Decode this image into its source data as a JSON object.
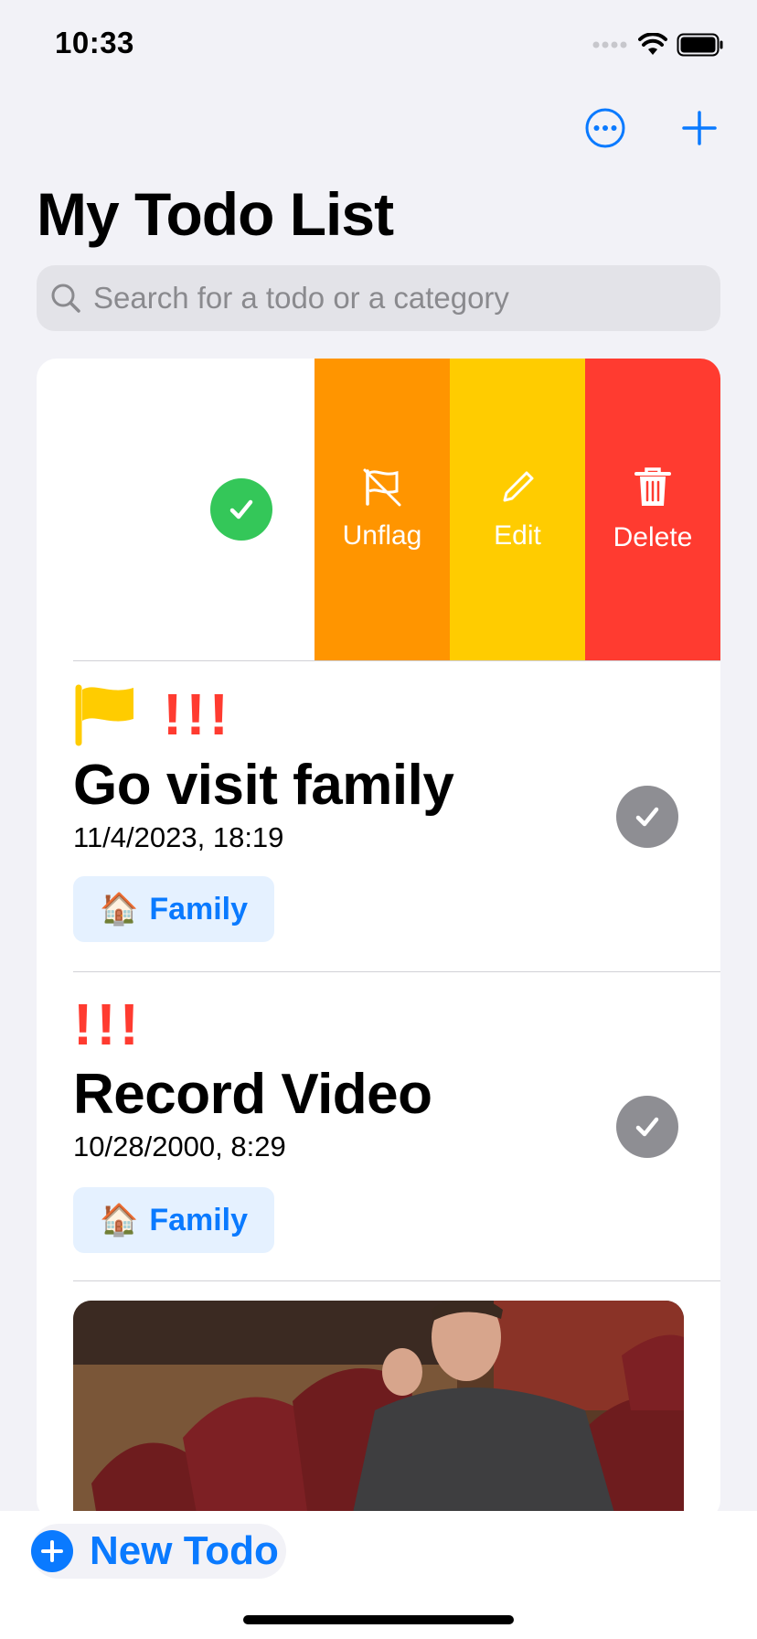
{
  "status_bar": {
    "time": "10:33"
  },
  "nav": {
    "more_icon": "ellipsis-circle-icon",
    "add_icon": "plus-icon"
  },
  "page": {
    "title": "My Todo List"
  },
  "search": {
    "placeholder": "Search for a todo or a category",
    "value": ""
  },
  "swipe_actions": {
    "unflag_label": "Unflag",
    "edit_label": "Edit",
    "delete_label": "Delete",
    "colors": {
      "unflag": "#ff9500",
      "edit": "#ffcc00",
      "delete": "#ff3b30",
      "complete": "#34c759"
    }
  },
  "todos": [
    {
      "flagged": true,
      "priority": "!!!",
      "title": "Go visit family",
      "date": "11/4/2023, 18:19",
      "category": {
        "emoji": "🏠",
        "name": "Family"
      }
    },
    {
      "flagged": false,
      "priority": "!!!",
      "title": "Record Video",
      "date": "10/28/2000, 8:29",
      "category": {
        "emoji": "🏠",
        "name": "Family"
      }
    }
  ],
  "toolbar": {
    "new_todo_label": "New Todo"
  },
  "colors": {
    "accent": "#0a7aff",
    "priority": "#ff3b30",
    "flag": "#ffcc00",
    "background": "#f2f2f7"
  }
}
